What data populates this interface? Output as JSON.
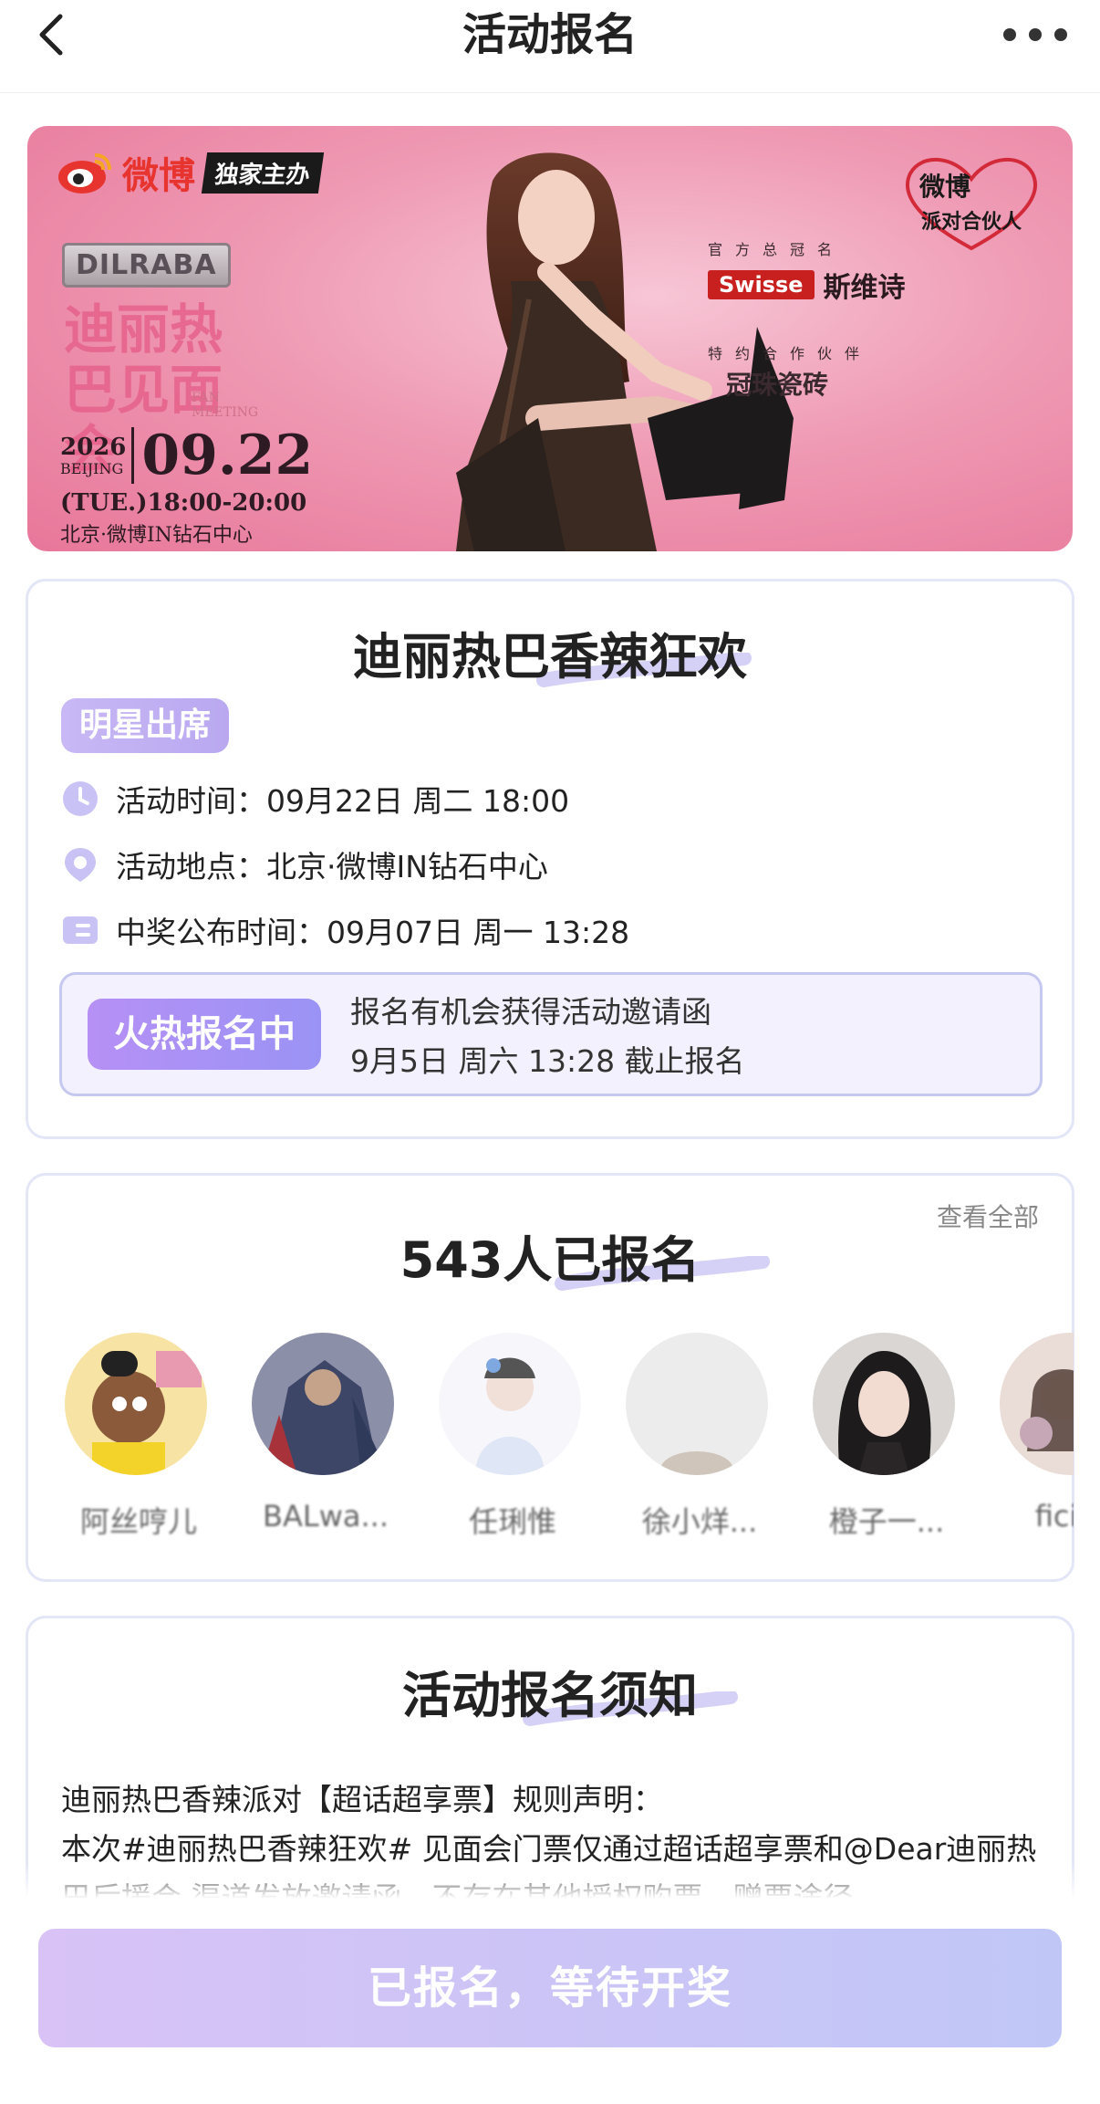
{
  "nav": {
    "title": "活动报名",
    "back_icon": "back-chevron-icon",
    "more_icon": "more-dots-icon"
  },
  "banner": {
    "weibo_logo_text": "微博",
    "exclusive_label": "独家主办",
    "artist_logo": "DILRABA",
    "event_title": "迪丽热巴见面会",
    "fan_meeting": "FAN MEETING",
    "year": "2026",
    "city": "BEIJING",
    "month_day": "09.22",
    "time": "(TUE.)18:00-20:00",
    "venue": "北京·微博IN钻石中心",
    "partner_badge": "微博派对合伙人",
    "sponsor_label": "官方总冠名",
    "sponsor_brand": "Swisse",
    "sponsor_cn": "斯维诗",
    "partner_label": "特约合作伙伴",
    "partner_brand": "冠珠瓷砖"
  },
  "event": {
    "title": "迪丽热巴香辣狂欢",
    "tag": "明星出席",
    "time_label": "活动时间：09月22日 周二 18:00",
    "place_label": "活动地点：北京·微博IN钻石中心",
    "result_label": "中奖公布时间：09月07日 周一 13:28",
    "status_button": "火热报名中",
    "status_line1": "报名有机会获得活动邀请函",
    "status_line2": "9月5日 周六 13:28 截止报名"
  },
  "signups": {
    "title": "543人已报名",
    "see_all": "查看全部",
    "users": [
      {
        "name": "阿丝哼儿"
      },
      {
        "name": "BALwa..."
      },
      {
        "name": "任琍惟"
      },
      {
        "name": "徐小烊..."
      },
      {
        "name": "橙子一..."
      },
      {
        "name": "ficinc"
      }
    ]
  },
  "notice": {
    "title": "活动报名须知",
    "line1": "迪丽热巴香辣派对【超话超享票】规则声明：",
    "line2": "本次#迪丽热巴香辣狂欢# 见面会门票仅通过超话超享票和@Dear迪丽热巴后援会 渠道发放邀请函，不存在其他授权购票、赠票途径。"
  },
  "footer": {
    "button": "已报名，等待开奖"
  },
  "colors": {
    "accent": "#9a93f5",
    "pink": "#ef9ab4",
    "weibo_red": "#e8342f"
  }
}
